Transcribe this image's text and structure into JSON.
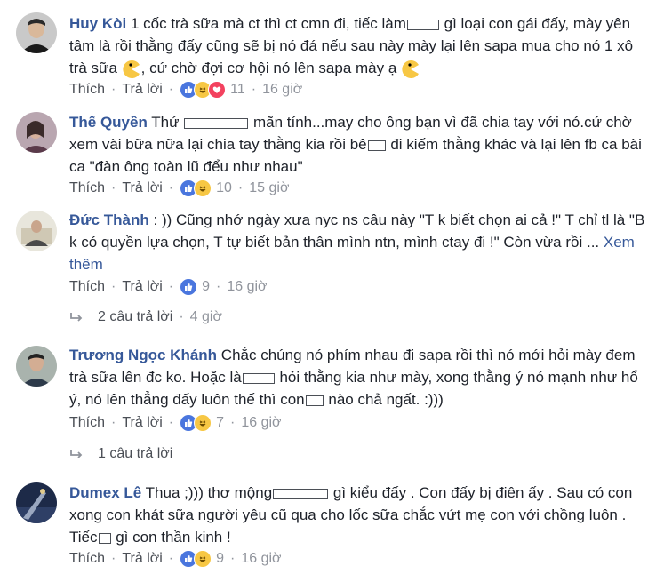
{
  "comments": [
    {
      "author": "Huy Kòi",
      "p1": "1 cốc trà sữa mà ct thì ct cmn đi, tiếc làm",
      "p2": " gì loại con gái đấy, mày yên tâm là rồi thằng đấy cũng sẽ bị nó đá nếu sau này mày lại lên sapa mua cho nó 1 xô trà sữa ",
      "p3": ", cứ chờ đợi cơ hội nó lên sapa mày ạ ",
      "like": "Thích",
      "reply": "Trả lời",
      "reactions": "11",
      "time": "16 giờ"
    },
    {
      "author": "Thế Quyền",
      "p1": "Thứ ",
      "p2": " mãn tính...may cho ông bạn vì đã chia tay với nó.cứ chờ xem vài bữa nữa lại chia tay thằng kia rồi bê",
      "p3": " đi kiếm thằng khác và lại lên fb ca bài ca \"đàn ông toàn lũ đểu như nhau\"",
      "like": "Thích",
      "reply": "Trả lời",
      "reactions": "10",
      "time": "15 giờ"
    },
    {
      "author": "Đức Thành",
      "p1": ": )) Cũng nhớ ngày xưa nyc ns câu này \"T k biết chọn ai cả !\" T chỉ tl là \"B k có quyền lựa chọn, T tự biết bản thân mình ntn, mình ctay đi !\" Còn vừa rồi ... ",
      "more": "Xem thêm",
      "like": "Thích",
      "reply": "Trả lời",
      "reactions": "9",
      "time": "16 giờ",
      "replies": "2 câu trả lời",
      "replies_time": "4 giờ"
    },
    {
      "author": "Trương Ngọc Khánh",
      "p1": "Chắc chúng nó phím nhau đi sapa rồi thì nó mới hỏi mày đem trà sữa lên đc ko. Hoặc là",
      "p2": " hỏi thằng kia như mày, xong thằng ý nó mạnh như hổ ý, nó lên thẳng đấy luôn thế thì con",
      "p3": " nào chả ngất. :)))",
      "like": "Thích",
      "reply": "Trả lời",
      "reactions": "7",
      "time": "16 giờ",
      "replies": "1 câu trả lời"
    },
    {
      "author": "Dumex Lê",
      "p1": "Thua ;))) thơ mộng",
      "p2": " gì kiểu đấy . Con đấy bị điên ấy . Sau có con xong con khát sữa người yêu cũ qua cho lốc sữa chắc vứt mẹ con với chồng luôn . Tiếc",
      "p3": " gì con thần kinh !",
      "like": "Thích",
      "reply": "Trả lời",
      "reactions": "9",
      "time": "16 giờ"
    }
  ]
}
